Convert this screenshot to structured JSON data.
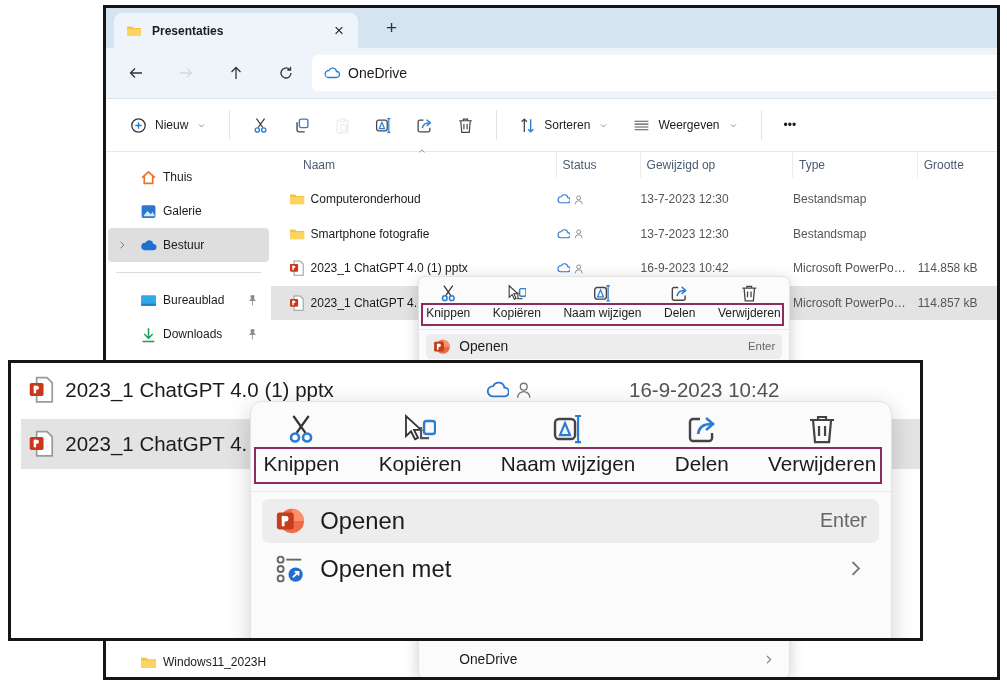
{
  "tabs": [
    {
      "title": "Presentaties",
      "selected": true,
      "close": "×"
    }
  ],
  "new_tab": "+",
  "navigation": {
    "buttons": [
      {
        "kind": "back",
        "disabled": false
      },
      {
        "kind": "forward",
        "disabled": true
      },
      {
        "kind": "up",
        "disabled": false
      },
      {
        "kind": "refresh",
        "disabled": false
      }
    ],
    "address": "OneDrive"
  },
  "toolbar": {
    "items": [
      {
        "kind": "new",
        "label": "Nieuw",
        "dropdown": true,
        "disabled": false
      },
      {
        "kind": "separator"
      },
      {
        "kind": "cut",
        "disabled": false,
        "dropdown": false
      },
      {
        "kind": "copy",
        "disabled": false,
        "dropdown": false
      },
      {
        "kind": "paste",
        "disabled": true,
        "dropdown": false
      },
      {
        "kind": "rename",
        "disabled": false,
        "dropdown": false
      },
      {
        "kind": "share",
        "disabled": false,
        "dropdown": false
      },
      {
        "kind": "delete",
        "disabled": false,
        "dropdown": false
      },
      {
        "kind": "separator"
      },
      {
        "kind": "sort",
        "label": "Sorteren",
        "dropdown": true,
        "disabled": false
      },
      {
        "kind": "view",
        "label": "Weergeven",
        "dropdown": true,
        "disabled": false
      },
      {
        "kind": "separator"
      },
      {
        "kind": "more",
        "label": "•••",
        "dropdown": false,
        "disabled": false
      }
    ]
  },
  "sidebar": {
    "groups": [
      {
        "items": [
          {
            "kind": "home",
            "label": "Thuis",
            "selected": false,
            "expandable": false,
            "pinned": false
          },
          {
            "kind": "gallery",
            "label": "Galerie",
            "selected": false,
            "expandable": false,
            "pinned": false
          },
          {
            "kind": "onedrive",
            "label": "Bestuur",
            "selected": true,
            "expandable": true,
            "pinned": false
          }
        ]
      },
      {
        "items": [
          {
            "kind": "desktop",
            "label": "Bureaublad",
            "selected": false,
            "expandable": false,
            "pinned": true
          },
          {
            "kind": "download",
            "label": "Downloads",
            "selected": false,
            "expandable": false,
            "pinned": true
          }
        ]
      }
    ],
    "bottom_items": [
      {
        "kind": "folder",
        "label": "Windows11_2023H",
        "selected": false,
        "expandable": false,
        "pinned": false
      }
    ]
  },
  "file_list": {
    "columns": [
      {
        "label": "Naam",
        "sorted": true
      },
      {
        "label": "Status",
        "sorted": false
      },
      {
        "label": "Gewijzigd op",
        "sorted": false
      },
      {
        "label": "Type",
        "sorted": false
      },
      {
        "label": "Grootte",
        "sorted": false
      }
    ],
    "rows": [
      {
        "kind": "folder",
        "name": "Computeronderhoud",
        "synced": true,
        "modified": "13-7-2023 12:30",
        "type": "Bestandsmap",
        "selected": false
      },
      {
        "kind": "folder",
        "name": "Smartphone fotografie",
        "synced": true,
        "modified": "13-7-2023 12:30",
        "type": "Bestandsmap",
        "selected": false
      },
      {
        "kind": "pptx",
        "name": "2023_1 ChatGPT 4.0 (1) pptx",
        "synced": true,
        "modified": "16-9-2023 10:42",
        "type": "Microsoft PowerPo…",
        "size": "114.858 kB",
        "selected": false
      },
      {
        "kind": "pptx",
        "name": "2023_1 ChatGPT 4.",
        "synced": false,
        "type": "Microsoft PowerPo…",
        "size": "114.857 kB",
        "selected": true
      }
    ]
  },
  "context_menu": {
    "annotated": true,
    "actions": [
      {
        "kind": "cut",
        "label": "Knippen"
      },
      {
        "kind": "copy",
        "label": "Kopiëren"
      },
      {
        "kind": "rename",
        "label": "Naam wijzigen"
      },
      {
        "kind": "share",
        "label": "Delen"
      },
      {
        "kind": "delete",
        "label": "Verwijderen"
      }
    ],
    "items": [
      {
        "kind": "powerpoint",
        "label": "Openen",
        "shortcut": "Enter",
        "highlighted": true,
        "submenu": false
      }
    ],
    "bottom_items": [
      {
        "kind": "plain",
        "label": "OneDrive",
        "highlighted": false,
        "submenu": true
      }
    ]
  },
  "inset": {
    "rows": [
      {
        "kind": "pptx",
        "name": "2023_1 ChatGPT 4.0 (1) pptx",
        "synced": true,
        "modified": "16-9-2023 10:42",
        "selected": false
      },
      {
        "kind": "pptx",
        "name": "2023_1 ChatGPT 4.",
        "synced": false,
        "selected": true
      }
    ],
    "context_menu": {
      "annotated": true,
      "actions": [
        {
          "kind": "cut",
          "label": "Knippen"
        },
        {
          "kind": "copy",
          "label": "Kopiëren"
        },
        {
          "kind": "rename",
          "label": "Naam wijzigen"
        },
        {
          "kind": "share",
          "label": "Delen"
        },
        {
          "kind": "delete",
          "label": "Verwijderen"
        }
      ],
      "items": [
        {
          "kind": "powerpoint",
          "label": "Openen",
          "shortcut": "Enter",
          "highlighted": true,
          "submenu": false
        },
        {
          "kind": "open_with",
          "label": "Openen met",
          "highlighted": false,
          "submenu": true
        }
      ]
    }
  }
}
